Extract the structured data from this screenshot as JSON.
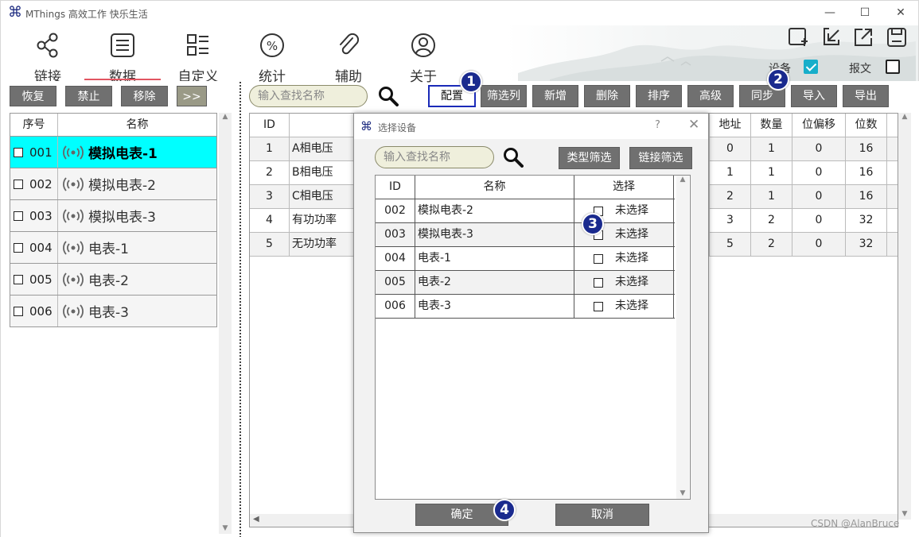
{
  "window": {
    "title": "MThings 高效工作 快乐生活",
    "minimize": "—",
    "maximize": "☐",
    "close": "✕"
  },
  "nav": {
    "items": [
      {
        "label": "链接",
        "icon": "share-icon"
      },
      {
        "label": "数据",
        "icon": "list-icon"
      },
      {
        "label": "自定义",
        "icon": "grid-list-icon"
      },
      {
        "label": "统计",
        "icon": "percent-icon"
      },
      {
        "label": "辅助",
        "icon": "paperclip-icon"
      },
      {
        "label": "关于",
        "icon": "user-icon"
      }
    ],
    "active": "数据",
    "device_label": "设备",
    "device_checked": true,
    "message_label": "报文",
    "message_checked": false
  },
  "left": {
    "buttons": [
      "恢复",
      "禁止",
      "移除",
      ">>"
    ],
    "headers": [
      "序号",
      "名称"
    ],
    "rows": [
      {
        "id": "001",
        "name": "模拟电表-1",
        "selected": true
      },
      {
        "id": "002",
        "name": "模拟电表-2"
      },
      {
        "id": "003",
        "name": "模拟电表-3"
      },
      {
        "id": "004",
        "name": "电表-1"
      },
      {
        "id": "005",
        "name": "电表-2"
      },
      {
        "id": "006",
        "name": "电表-3"
      }
    ]
  },
  "right": {
    "search_placeholder": "输入查找名称",
    "buttons": [
      "配置",
      "筛选列",
      "新增",
      "删除",
      "排序",
      "高级",
      "同步",
      "导入",
      "导出"
    ],
    "headers": {
      "id": "ID",
      "addr": "地址",
      "count": "数量",
      "offset": "位偏移",
      "bits": "位数"
    },
    "rows": [
      {
        "id": "1",
        "name": "A相电压",
        "addr": "0",
        "count": "1",
        "offset": "0",
        "bits": "16"
      },
      {
        "id": "2",
        "name": "B相电压",
        "addr": "1",
        "count": "1",
        "offset": "0",
        "bits": "16"
      },
      {
        "id": "3",
        "name": "C相电压",
        "addr": "2",
        "count": "1",
        "offset": "0",
        "bits": "16"
      },
      {
        "id": "4",
        "name": "有功功率",
        "addr": "3",
        "count": "2",
        "offset": "0",
        "bits": "32"
      },
      {
        "id": "5",
        "name": "无功功率",
        "addr": "5",
        "count": "2",
        "offset": "0",
        "bits": "32"
      }
    ]
  },
  "dialog": {
    "title": "选择设备",
    "help": "?",
    "close": "✕",
    "search_placeholder": "输入查找名称",
    "filter_type": "类型筛选",
    "filter_link": "链接筛选",
    "headers": [
      "ID",
      "名称",
      "选择"
    ],
    "rows": [
      {
        "id": "002",
        "name": "模拟电表-2",
        "state": "未选择"
      },
      {
        "id": "003",
        "name": "模拟电表-3",
        "state": "未选择"
      },
      {
        "id": "004",
        "name": "电表-1",
        "state": "未选择"
      },
      {
        "id": "005",
        "name": "电表-2",
        "state": "未选择"
      },
      {
        "id": "006",
        "name": "电表-3",
        "state": "未选择"
      }
    ],
    "ok": "确定",
    "cancel": "取消"
  },
  "badges": [
    "1",
    "2",
    "3",
    "4"
  ],
  "watermark": "CSDN @AlanBruce",
  "colors": {
    "accent": "#1a2a8e",
    "selected_row": "#00ffff",
    "button_gray": "#707070",
    "active_underline": "#e25561"
  }
}
